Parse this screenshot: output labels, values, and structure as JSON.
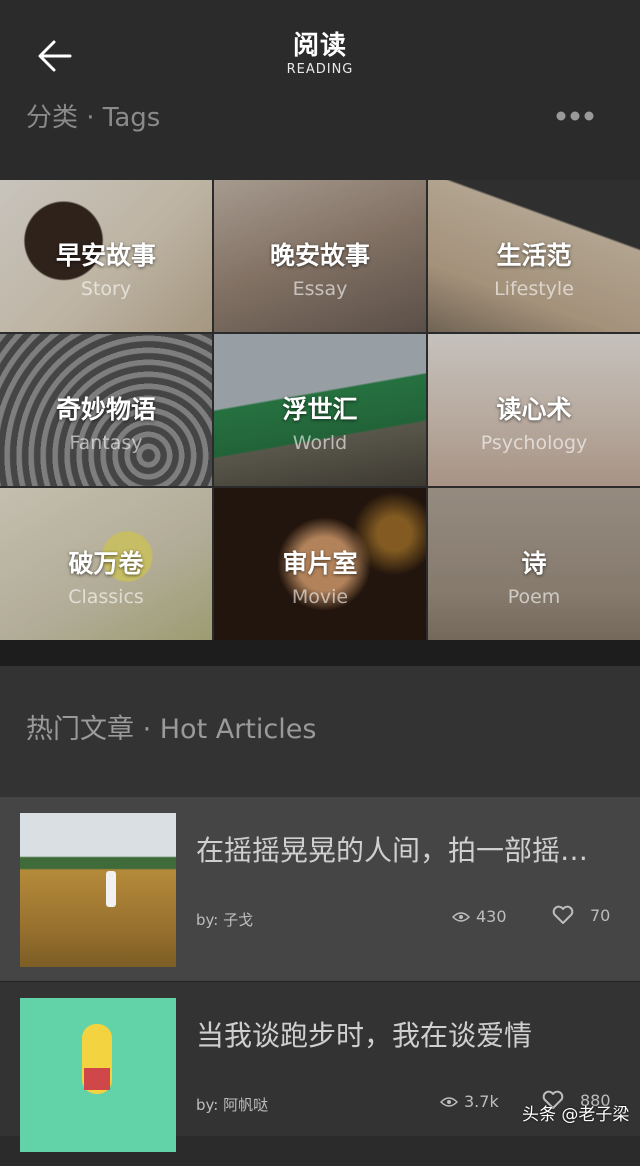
{
  "header": {
    "title": "阅读",
    "subtitle": "READING"
  },
  "tags": {
    "label": "分类 · Tags",
    "items": [
      {
        "cn": "早安故事",
        "en": "Story"
      },
      {
        "cn": "晚安故事",
        "en": "Essay"
      },
      {
        "cn": "生活范",
        "en": "Lifestyle"
      },
      {
        "cn": "奇妙物语",
        "en": "Fantasy"
      },
      {
        "cn": "浮世汇",
        "en": "World"
      },
      {
        "cn": "读心术",
        "en": "Psychology"
      },
      {
        "cn": "破万卷",
        "en": "Classics"
      },
      {
        "cn": "审片室",
        "en": "Movie"
      },
      {
        "cn": "诗",
        "en": "Poem"
      }
    ]
  },
  "hot": {
    "title": "热门文章 · Hot Articles",
    "articles": [
      {
        "title": "在摇摇晃晃的人间，拍一部摇…",
        "author": "by: 子戈",
        "views": "430",
        "likes": "70"
      },
      {
        "title": "当我谈跑步时，我在谈爱情",
        "author": "by: 阿帆哒",
        "views": "3.7k",
        "likes": "880"
      }
    ]
  },
  "watermark": "头条 @老子梁"
}
